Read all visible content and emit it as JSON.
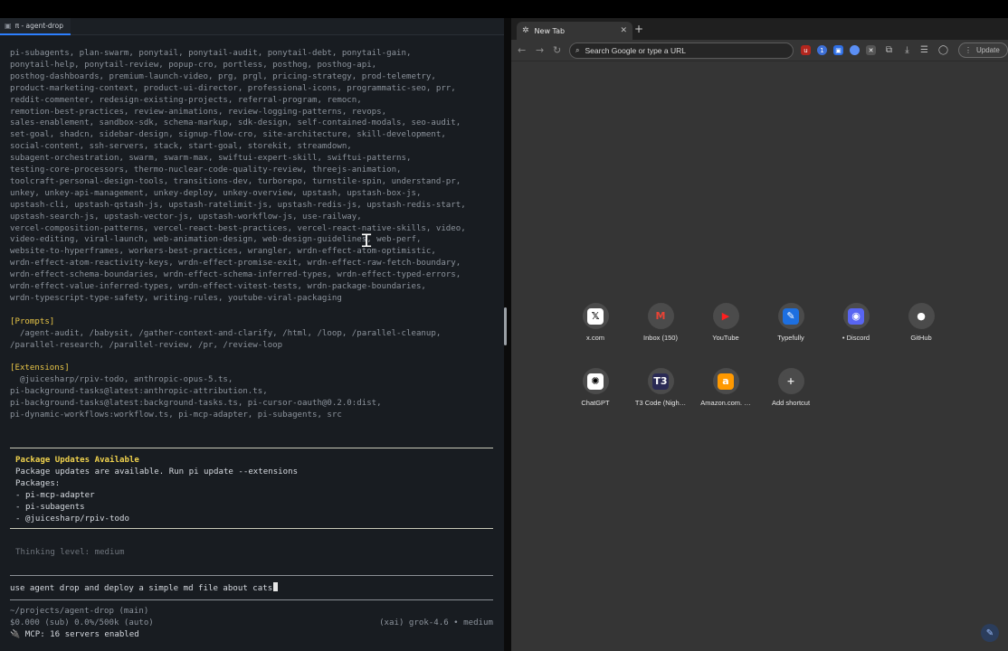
{
  "terminal": {
    "tab_title": "π - agent-drop",
    "skills_lines": [
      "pi-subagents, plan-swarm, ponytail, ponytail-audit, ponytail-debt, ponytail-gain,",
      "ponytail-help, ponytail-review, popup-cro, portless, posthog, posthog-api,",
      "posthog-dashboards, premium-launch-video, prg, prgl, pricing-strategy, prod-telemetry,",
      "product-marketing-context, product-ui-director, professional-icons, programmatic-seo, prr,",
      "reddit-commenter, redesign-existing-projects, referral-program, remocn,",
      "remotion-best-practices, review-animations, review-logging-patterns, revops,",
      "sales-enablement, sandbox-sdk, schema-markup, sdk-design, self-contained-modals, seo-audit,",
      "set-goal, shadcn, sidebar-design, signup-flow-cro, site-architecture, skill-development,",
      "social-content, ssh-servers, stack, start-goal, storekit, streamdown,",
      "subagent-orchestration, swarm, swarm-max, swiftui-expert-skill, swiftui-patterns,",
      "testing-core-processors, thermo-nuclear-code-quality-review, threejs-animation,",
      "toolcraft-personal-design-tools, transitions-dev, turborepo, turnstile-spin, understand-pr,",
      "unkey, unkey-api-management, unkey-deploy, unkey-overview, upstash, upstash-box-js,",
      "upstash-cli, upstash-qstash-js, upstash-ratelimit-js, upstash-redis-js, upstash-redis-start,",
      "upstash-search-js, upstash-vector-js, upstash-workflow-js, use-railway,",
      "vercel-composition-patterns, vercel-react-best-practices, vercel-react-native-skills, video,",
      "video-editing, viral-launch, web-animation-design, web-design-guidelines, web-perf,",
      "website-to-hyperframes, workers-best-practices, wrangler, wrdn-effect-atom-optimistic,",
      "wrdn-effect-atom-reactivity-keys, wrdn-effect-promise-exit, wrdn-effect-raw-fetch-boundary,",
      "wrdn-effect-schema-boundaries, wrdn-effect-schema-inferred-types, wrdn-effect-typed-errors,",
      "wrdn-effect-value-inferred-types, wrdn-effect-vitest-tests, wrdn-package-boundaries,",
      "wrdn-typescript-type-safety, writing-rules, youtube-viral-packaging"
    ],
    "prompts_header": "[Prompts]",
    "prompts_lines": [
      "  /agent-audit, /babysit, /gather-context-and-clarify, /html, /loop, /parallel-cleanup,",
      "/parallel-research, /parallel-review, /pr, /review-loop"
    ],
    "extensions_header": "[Extensions]",
    "extensions_lines": [
      "  @juicesharp/rpiv-todo, anthropic-opus-5.ts,",
      "pi-background-tasks@latest:anthropic-attribution.ts,",
      "pi-background-tasks@latest:background-tasks.ts, pi-cursor-oauth@0.2.0:dist,",
      "pi-dynamic-workflows:workflow.ts, pi-mcp-adapter, pi-subagents, src"
    ],
    "updates": {
      "title": "Package Updates Available",
      "line": "Package updates are available. Run pi update --extensions",
      "packages_label": "Packages:",
      "packages": [
        "- pi-mcp-adapter",
        "- pi-subagents",
        "- @juicesharp/rpiv-todo"
      ]
    },
    "thinking_level": "Thinking level: medium",
    "input_text": "use agent drop and deploy a simple md file about cats",
    "status": {
      "cwd": "~/projects/agent-drop (main)",
      "usage": "$0.000 (sub) 0.0%/500k (auto)",
      "model": "(xai) grok-4.6 • medium",
      "mcp": "🔌 MCP: 16 servers enabled"
    }
  },
  "browser": {
    "tab_title": "New Tab",
    "omnibox_placeholder": "Search Google or type a URL",
    "update_label": "Update",
    "shortcuts": [
      {
        "label": "x.com",
        "icon": "x-logo-icon"
      },
      {
        "label": "Inbox (150)",
        "icon": "gmail-icon"
      },
      {
        "label": "YouTube",
        "icon": "youtube-icon"
      },
      {
        "label": "Typefully",
        "icon": "typefully-icon"
      },
      {
        "label": "• Discord",
        "icon": "discord-icon"
      },
      {
        "label": "GitHub",
        "icon": "github-icon"
      },
      {
        "label": "ChatGPT",
        "icon": "chatgpt-icon"
      },
      {
        "label": "T3 Code (Nigh…",
        "icon": "t3-icon"
      },
      {
        "label": "Amazon.com. …",
        "icon": "amazon-icon"
      },
      {
        "label": "Add shortcut",
        "icon": "plus-icon"
      }
    ],
    "colors": {
      "accent": "#2c7fff",
      "tab_bg": "#353535",
      "terminal_bg": "#181c21"
    }
  }
}
